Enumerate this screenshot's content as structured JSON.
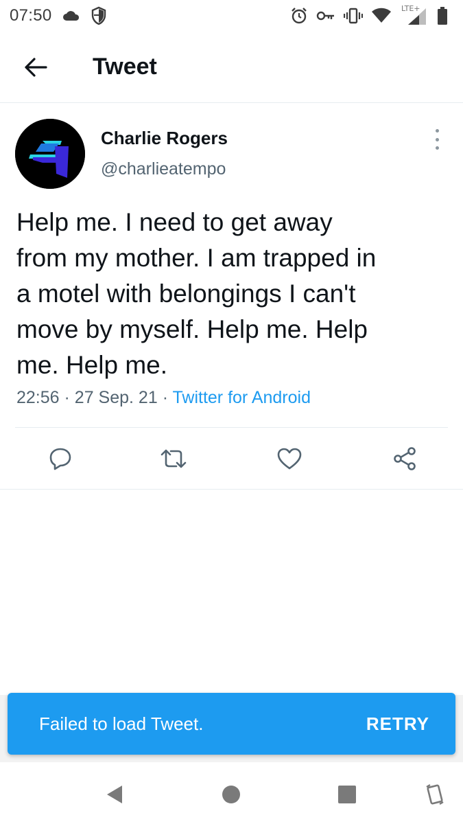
{
  "status_bar": {
    "time": "07:50",
    "network_label": "LTE+",
    "icons": [
      "cloud-icon",
      "shield-icon",
      "alarm-icon",
      "key-icon",
      "vibrate-icon",
      "wifi-icon",
      "signal-icon",
      "battery-icon"
    ]
  },
  "header": {
    "back_icon": "arrow-left-icon",
    "title": "Tweet"
  },
  "tweet": {
    "author_name": "Charlie Rogers",
    "author_handle": "@charlieatempo",
    "text": "Help me. I need to get away\nfrom my mother. I am trapped in\na motel with belongings I can't\nmove by myself. Help me. Help\nme. Help me.",
    "time": "22:56",
    "date": "27 Sep. 21",
    "separator": "·",
    "source": "Twitter for Android",
    "actions": [
      "reply-icon",
      "retweet-icon",
      "like-icon",
      "share-icon"
    ]
  },
  "snackbar": {
    "message": "Failed to load Tweet.",
    "action_label": "RETRY",
    "color": "#1d9bf0"
  },
  "nav_bar": {
    "icons": [
      "back-triangle-icon",
      "home-circle-icon",
      "recents-square-icon",
      "rotate-icon"
    ]
  },
  "colors": {
    "accent": "#1d9bf0",
    "text_primary": "#0f1419",
    "text_secondary": "#536471",
    "divider": "#e6ecf0"
  }
}
